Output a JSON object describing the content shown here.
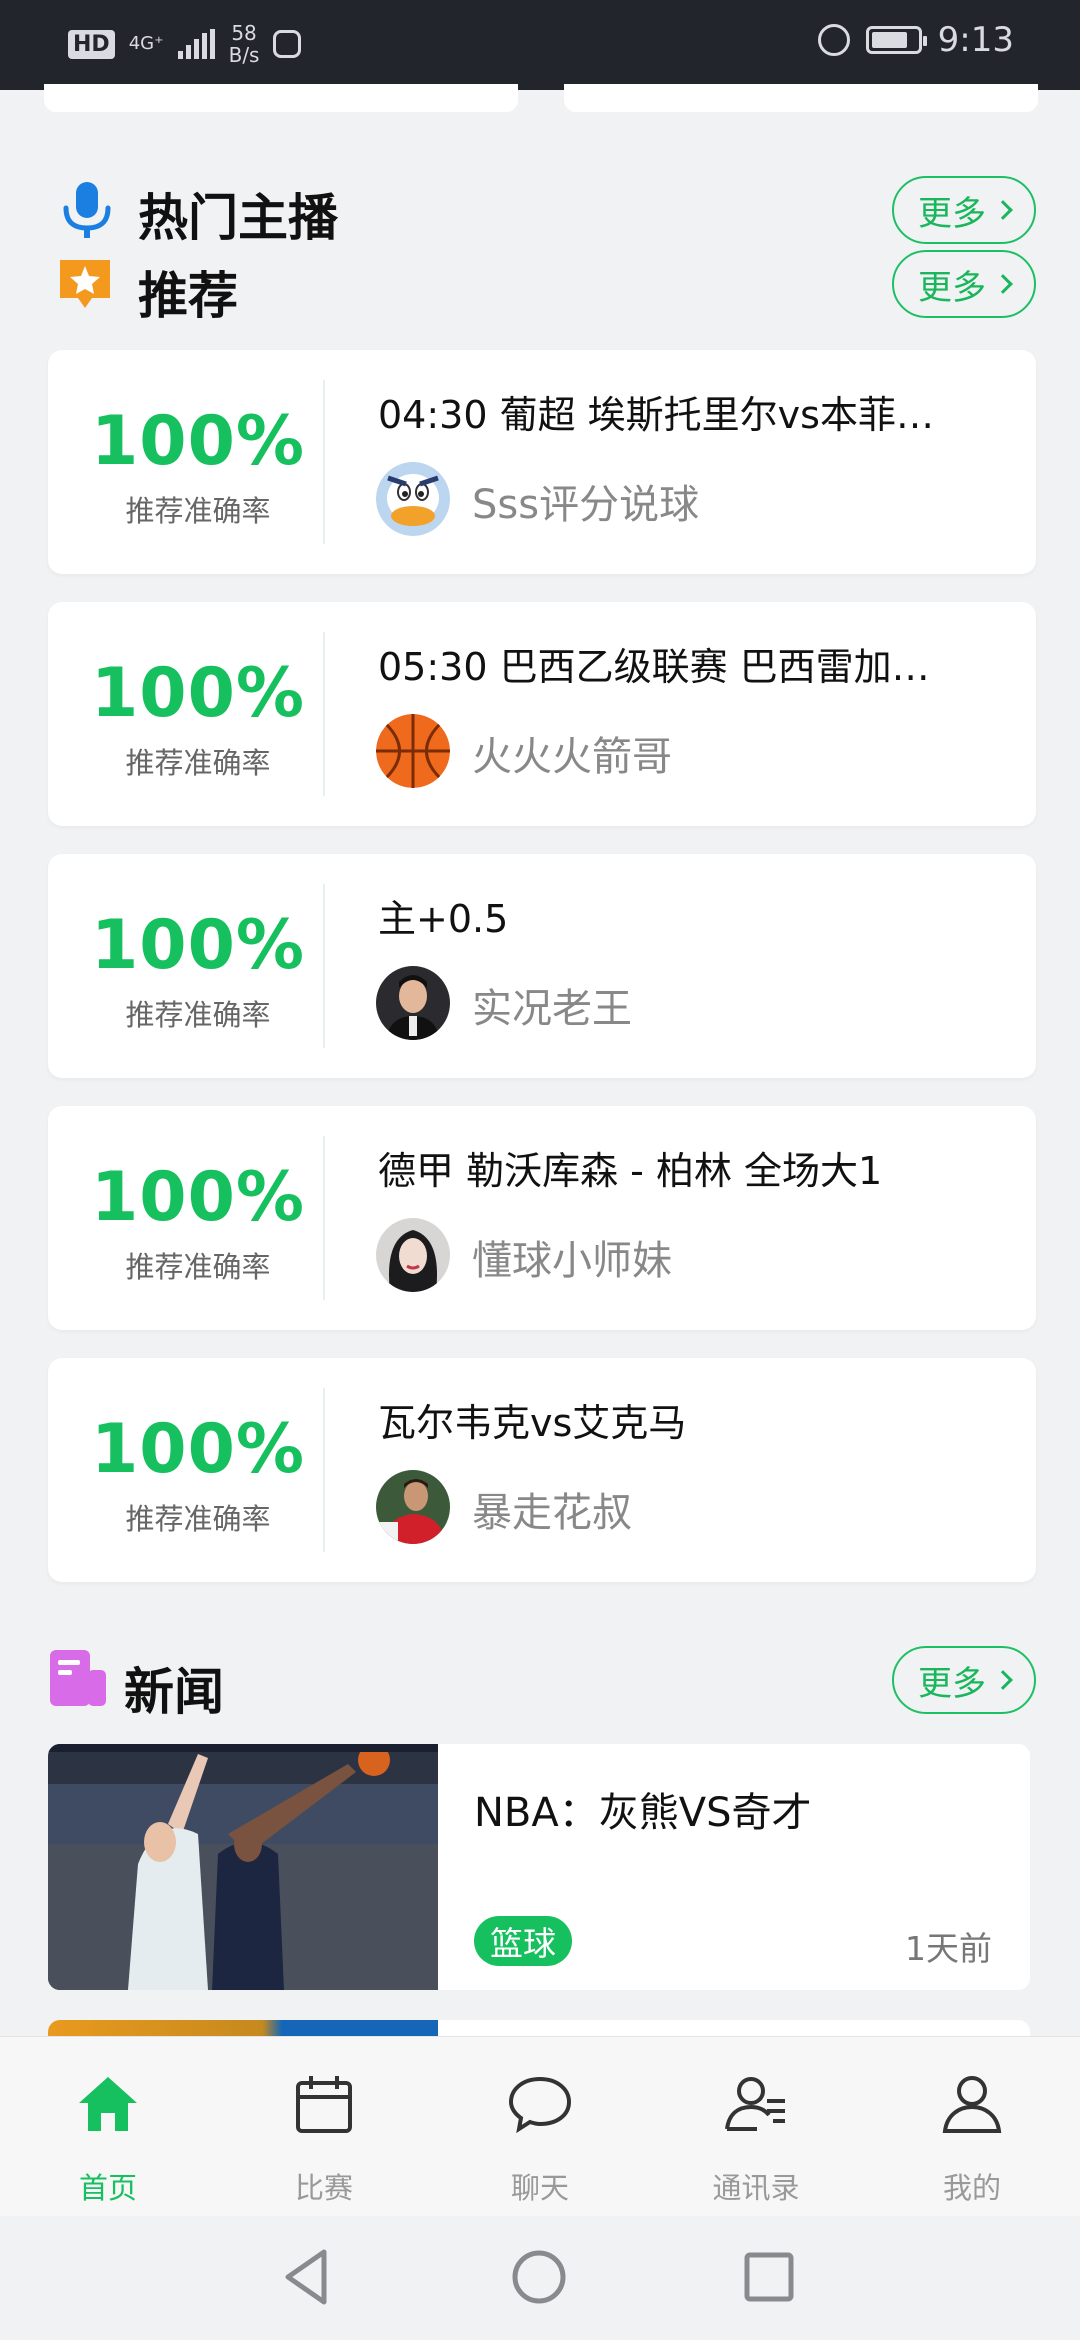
{
  "status_bar": {
    "hd": "HD",
    "network": "4G⁺",
    "speed_value": "58",
    "speed_unit": "B/s",
    "time": "9:13"
  },
  "sections": {
    "hot_anchor": {
      "title": "热门主播",
      "more": "更多"
    },
    "recommend": {
      "title": "推荐",
      "more": "更多"
    },
    "news": {
      "title": "新闻",
      "more": "更多"
    }
  },
  "recommend_cards": [
    {
      "pct": "100%",
      "pct_label": "推荐准确率",
      "title": "04:30 葡超 埃斯托里尔vs本菲…",
      "author": "Sss评分说球"
    },
    {
      "pct": "100%",
      "pct_label": "推荐准确率",
      "title": "05:30 巴西乙级联赛 巴西雷加…",
      "author": "火火火箭哥"
    },
    {
      "pct": "100%",
      "pct_label": "推荐准确率",
      "title": "主+0.5",
      "author": "实况老王"
    },
    {
      "pct": "100%",
      "pct_label": "推荐准确率",
      "title": "德甲 勒沃库森 - 柏林 全场大1",
      "author": "懂球小师妹"
    },
    {
      "pct": "100%",
      "pct_label": "推荐准确率",
      "title": "瓦尔韦克vs艾克马",
      "author": "暴走花叔"
    }
  ],
  "news_items": [
    {
      "title": "NBA：灰熊VS奇才",
      "tag": "篮球",
      "time": "1天前"
    }
  ],
  "bottom_nav": [
    {
      "label": "首页",
      "icon": "home-icon",
      "active": true
    },
    {
      "label": "比赛",
      "icon": "calendar-icon",
      "active": false
    },
    {
      "label": "聊天",
      "icon": "chat-icon",
      "active": false
    },
    {
      "label": "通讯录",
      "icon": "contacts-icon",
      "active": false
    },
    {
      "label": "我的",
      "icon": "profile-icon",
      "active": false
    }
  ],
  "colors": {
    "accent": "#17c05e",
    "mic_icon": "#1a7fe0",
    "recommend_icon": "#f39a1e",
    "news_icon": "#d86be8"
  }
}
